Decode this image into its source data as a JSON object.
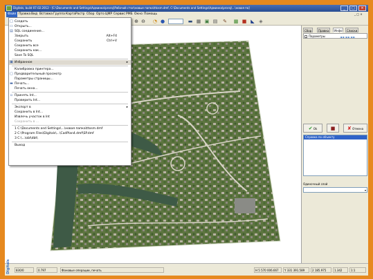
{
  "window": {
    "title": "Digitals, build 07.02.2012 - [C:\\Documents and Settings\\Админка\\proraj\\Рабочий стол\\новые папка\\ttosm.dmf, C:\\Documents and Settings\\Админка\\proraj\\...\\новая па]",
    "min": "_",
    "max": "□",
    "close": "×"
  },
  "menubar": {
    "items": [
      "Файл",
      "Правка",
      "Вид",
      "Вставка",
      "Группа",
      "Карта",
      "Растр",
      "Сбор",
      "Орто",
      "ЦМР",
      "Сервис",
      "РМБ",
      "Окно",
      "Помощь"
    ],
    "mdi": "_ □ ×"
  },
  "file_menu": {
    "rows": [
      {
        "label": "Создать",
        "icon": "new-doc-icon",
        "glyph": "□"
      },
      {
        "label": "Открыть...",
        "icon": "open-folder-icon",
        "glyph": "▭"
      },
      {
        "label": "SQL соединение...",
        "icon": "sql-icon",
        "glyph": "▤"
      },
      {
        "label": "Закрыть",
        "shortcut": "Alt+F4"
      },
      {
        "label": "Сохранить",
        "shortcut": "Ctrl+V"
      },
      {
        "label": "Сохранить все"
      },
      {
        "label": "Сохранить как..."
      },
      {
        "label": "Save To SQL"
      },
      {
        "sep": true
      },
      {
        "label": "Избранное",
        "icon": "favorites-icon",
        "glyph": "▣",
        "submenu": true,
        "header": true
      },
      {
        "sep": true
      },
      {
        "label": "Калибровка принтера..."
      },
      {
        "label": "Предварительный просмотр",
        "icon": "preview-icon",
        "glyph": "▢"
      },
      {
        "label": "Параметры страницы..."
      },
      {
        "label": "Печать...",
        "icon": "print-icon",
        "glyph": "▬"
      },
      {
        "label": "Печать окна..."
      },
      {
        "sep": true
      },
      {
        "label": "Принять Int...",
        "icon": "import-icon",
        "glyph": "▫"
      },
      {
        "label": "Проверить Int..."
      },
      {
        "sep": true
      },
      {
        "label": "Экспорт в",
        "submenu": true
      },
      {
        "label": "Сохранить в Int..."
      },
      {
        "label": "Извлечь участок в Int"
      },
      {
        "label": "Сохранить в ...",
        "disabled": true
      },
      {
        "sep": true
      },
      {
        "label": "1 C:\\Documents and Settings\\...\\новая папка\\ttosm.dmf"
      },
      {
        "label": "2 C:\\Program Files\\Digitals\\...\\CadPlan4.dmf\\SP.dmf"
      },
      {
        "label": "3 C:\\...\\obl\\dbt\\"
      },
      {
        "sep": true
      },
      {
        "label": "Выход"
      }
    ]
  },
  "right_panel": {
    "tabs": [
      "Сбор",
      "Правка",
      "Инфо",
      "Списки"
    ],
    "active_tab": 2,
    "params_label": "Параметры",
    "nav": "◄◄ ◄ ► ►►",
    "ok_label": "Ok",
    "cancel_label": "Отмена",
    "object_list_header": "Справка по объекту",
    "layer_label": "Одиночный слой",
    "layer_value": "",
    "bottom_buttons": [
      "▯",
      "▥",
      "▮"
    ]
  },
  "status_bar": {
    "logo": "Digitals",
    "cells": [
      "830/0",
      "0.797",
      "Фоновые операции, печать",
      "H 5 570 006.667",
      "Y 331 391.589",
      "2 185.975",
      "1.342",
      "1:1"
    ]
  },
  "colors": {
    "frame": "#e6891f",
    "title_bar": "#274c92",
    "menu_highlight": "#3166c5",
    "water": "#3e5a46",
    "vegetation": "#4f6a36"
  }
}
